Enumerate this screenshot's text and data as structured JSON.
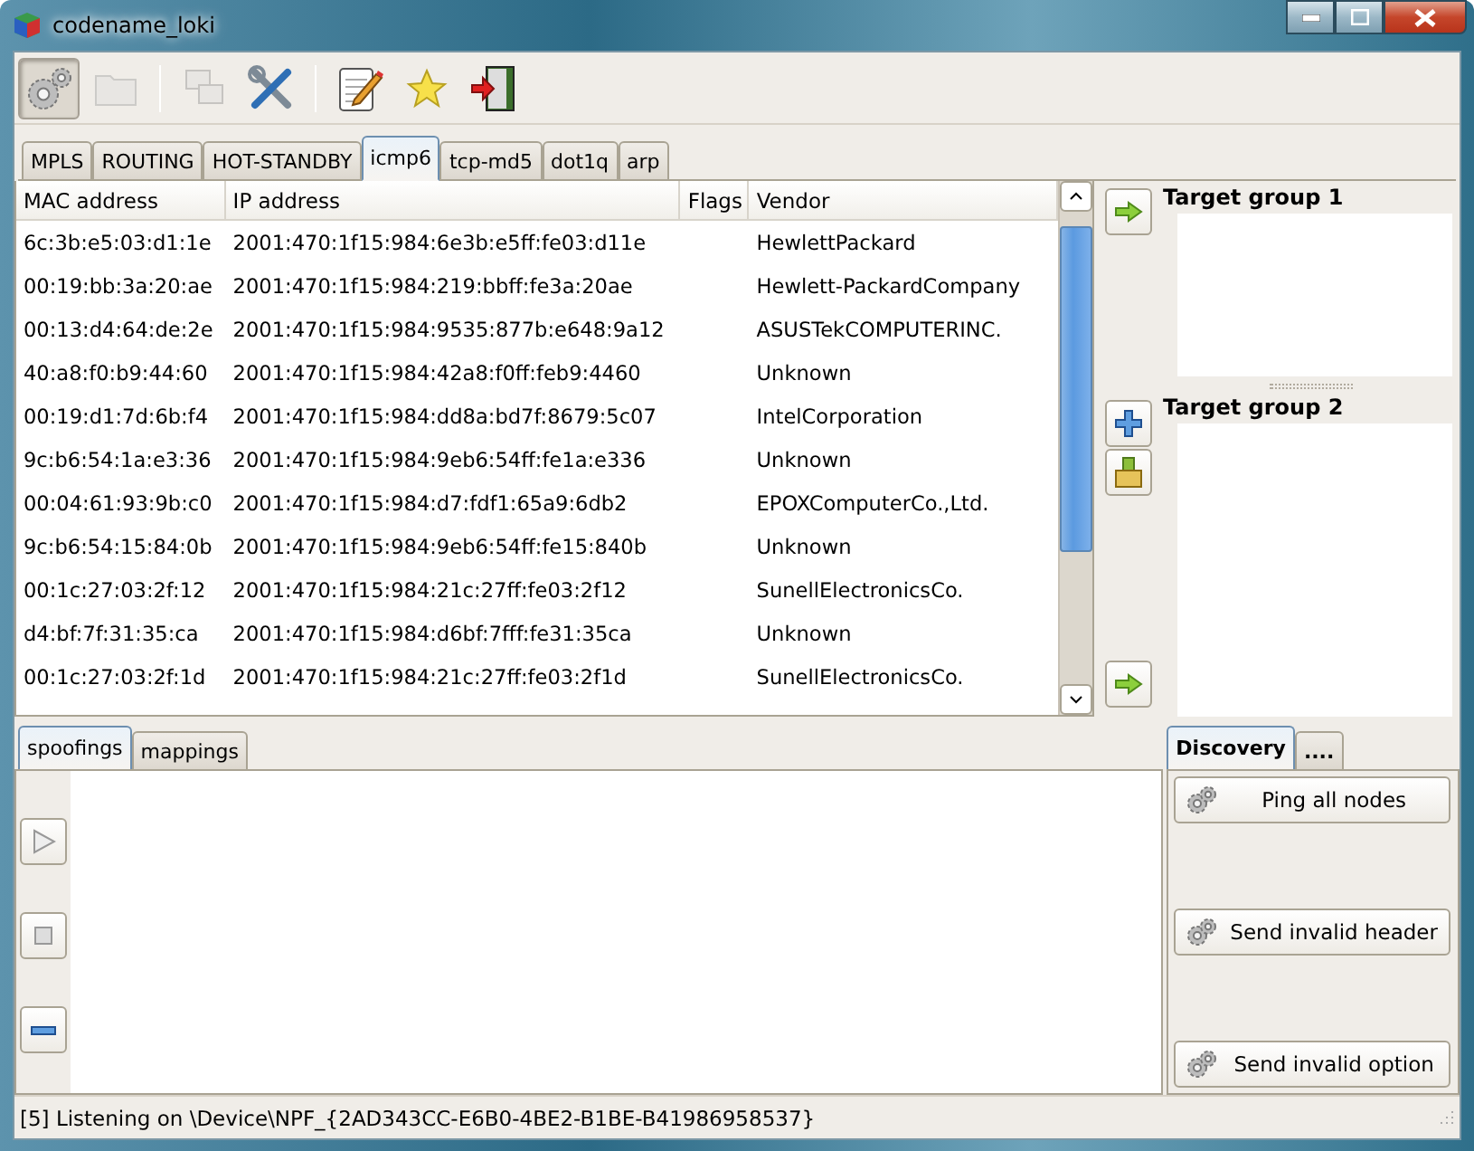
{
  "window": {
    "title": "codename_loki"
  },
  "toolbar": [
    {
      "kind": "button",
      "pressed": true,
      "disabled": false
    },
    {
      "kind": "button",
      "pressed": false,
      "disabled": true
    },
    {
      "kind": "separator"
    },
    {
      "kind": "button",
      "pressed": false,
      "disabled": true
    },
    {
      "kind": "button",
      "pressed": false,
      "disabled": false
    },
    {
      "kind": "separator"
    },
    {
      "kind": "button",
      "pressed": false,
      "disabled": false
    },
    {
      "kind": "button",
      "pressed": false,
      "disabled": false
    },
    {
      "kind": "button",
      "pressed": false,
      "disabled": false
    }
  ],
  "tabs": [
    {
      "label": "MPLS",
      "selected": false
    },
    {
      "label": "ROUTING",
      "selected": false
    },
    {
      "label": "HOT-STANDBY",
      "selected": false
    },
    {
      "label": "icmp6",
      "selected": true
    },
    {
      "label": "tcp-md5",
      "selected": false
    },
    {
      "label": "dot1q",
      "selected": false
    },
    {
      "label": "arp",
      "selected": false
    }
  ],
  "table": {
    "columns": [
      "MAC address",
      "IP address",
      "Flags",
      "Vendor"
    ],
    "rows": [
      [
        "6c:3b:e5:03:d1:1e",
        "2001:470:1f15:984:6e3b:e5ff:fe03:d11e",
        "",
        "HewlettPackard"
      ],
      [
        "00:19:bb:3a:20:ae",
        "2001:470:1f15:984:219:bbff:fe3a:20ae",
        "",
        "Hewlett-PackardCompany"
      ],
      [
        "00:13:d4:64:de:2e",
        "2001:470:1f15:984:9535:877b:e648:9a12",
        "",
        "ASUSTekCOMPUTERINC."
      ],
      [
        "40:a8:f0:b9:44:60",
        "2001:470:1f15:984:42a8:f0ff:feb9:4460",
        "",
        "Unknown"
      ],
      [
        "00:19:d1:7d:6b:f4",
        "2001:470:1f15:984:dd8a:bd7f:8679:5c07",
        "",
        "IntelCorporation"
      ],
      [
        "9c:b6:54:1a:e3:36",
        "2001:470:1f15:984:9eb6:54ff:fe1a:e336",
        "",
        "Unknown"
      ],
      [
        "00:04:61:93:9b:c0",
        "2001:470:1f15:984:d7:fdf1:65a9:6db2",
        "",
        "EPOXComputerCo.,Ltd."
      ],
      [
        "9c:b6:54:15:84:0b",
        "2001:470:1f15:984:9eb6:54ff:fe15:840b",
        "",
        "Unknown"
      ],
      [
        "00:1c:27:03:2f:12",
        "2001:470:1f15:984:21c:27ff:fe03:2f12",
        "",
        "SunellElectronicsCo."
      ],
      [
        "d4:bf:7f:31:35:ca",
        "2001:470:1f15:984:d6bf:7fff:fe31:35ca",
        "",
        "Unknown"
      ],
      [
        "00:1c:27:03:2f:1d",
        "2001:470:1f15:984:21c:27ff:fe03:2f1d",
        "",
        "SunellElectronicsCo."
      ]
    ]
  },
  "target_groups": [
    {
      "title": "Target group 1"
    },
    {
      "title": "Target group 2"
    }
  ],
  "lower_tabs": [
    {
      "label": "spoofings",
      "selected": true
    },
    {
      "label": "mappings",
      "selected": false
    }
  ],
  "side_tabs": [
    {
      "label": "Discovery",
      "selected": true
    },
    {
      "label": "....",
      "selected": false
    }
  ],
  "actions": [
    "Ping all nodes",
    "Send invalid header",
    "Send invalid option"
  ],
  "status_bar": "[5] Listening on \\Device\\NPF_{2AD343CC-E6B0-4BE2-B1BE-B41986958537}"
}
